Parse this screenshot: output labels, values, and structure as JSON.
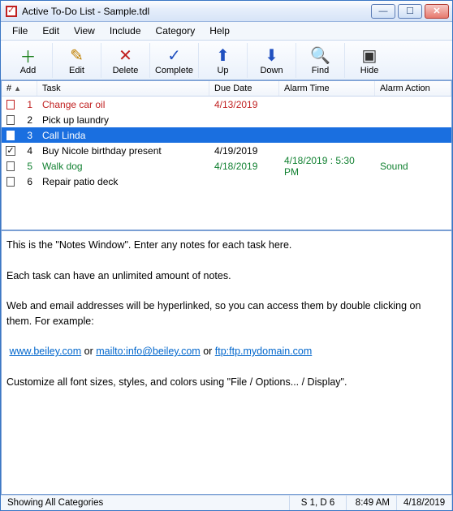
{
  "window": {
    "title": "Active To-Do List - Sample.tdl"
  },
  "menus": [
    "File",
    "Edit",
    "View",
    "Include",
    "Category",
    "Help"
  ],
  "toolbar": [
    {
      "id": "add",
      "label": "Add",
      "icon": "＋",
      "color": "#1a7f1a"
    },
    {
      "id": "edit",
      "label": "Edit",
      "icon": "✎",
      "color": "#c08000"
    },
    {
      "id": "delete",
      "label": "Delete",
      "icon": "✕",
      "color": "#c02020"
    },
    {
      "id": "complete",
      "label": "Complete",
      "icon": "✓",
      "color": "#2050c0"
    },
    {
      "id": "up",
      "label": "Up",
      "icon": "⬆",
      "color": "#2050c0"
    },
    {
      "id": "down",
      "label": "Down",
      "icon": "⬇",
      "color": "#2050c0"
    },
    {
      "id": "find",
      "label": "Find",
      "icon": "🔍",
      "color": "#806000"
    },
    {
      "id": "hide",
      "label": "Hide",
      "icon": "▣",
      "color": "#333"
    }
  ],
  "columns": {
    "num": "#",
    "task": "Task",
    "due": "Due Date",
    "alarm": "Alarm Time",
    "action": "Alarm Action"
  },
  "tasks": [
    {
      "num": "1",
      "task": "Change car oil",
      "due": "4/13/2019",
      "alarm": "",
      "action": "",
      "checked": false,
      "color": "red",
      "selected": false
    },
    {
      "num": "2",
      "task": "Pick up laundry",
      "due": "",
      "alarm": "",
      "action": "",
      "checked": false,
      "color": "black",
      "selected": false
    },
    {
      "num": "3",
      "task": "Call Linda",
      "due": "",
      "alarm": "",
      "action": "",
      "checked": false,
      "color": "black",
      "selected": true
    },
    {
      "num": "4",
      "task": "Buy Nicole birthday present",
      "due": "4/19/2019",
      "alarm": "",
      "action": "",
      "checked": true,
      "color": "black",
      "selected": false
    },
    {
      "num": "5",
      "task": "Walk dog",
      "due": "4/18/2019",
      "alarm": "4/18/2019 : 5:30 PM",
      "action": "Sound",
      "checked": false,
      "color": "green",
      "selected": false
    },
    {
      "num": "6",
      "task": "Repair patio deck",
      "due": "",
      "alarm": "",
      "action": "",
      "checked": false,
      "color": "black",
      "selected": false
    }
  ],
  "notes": {
    "line1": "This is the \"Notes Window\".  Enter any notes for each task here.",
    "line2": "Each task can have an unlimited amount of notes.",
    "line3": "Web and email addresses will be hyperlinked, so you can access them by double clicking on them.  For example:",
    "link1": "www.beiley.com",
    "sep1": " or ",
    "link2": "mailto:info@beiley.com",
    "sep2": " or ",
    "link3": "ftp:ftp.mydomain.com",
    "line4": "Customize all font sizes, styles, and colors using \"File / Options... / Display\"."
  },
  "status": {
    "left": "Showing All Categories",
    "sd": "S 1, D 6",
    "time": "8:49 AM",
    "date": "4/18/2019"
  }
}
